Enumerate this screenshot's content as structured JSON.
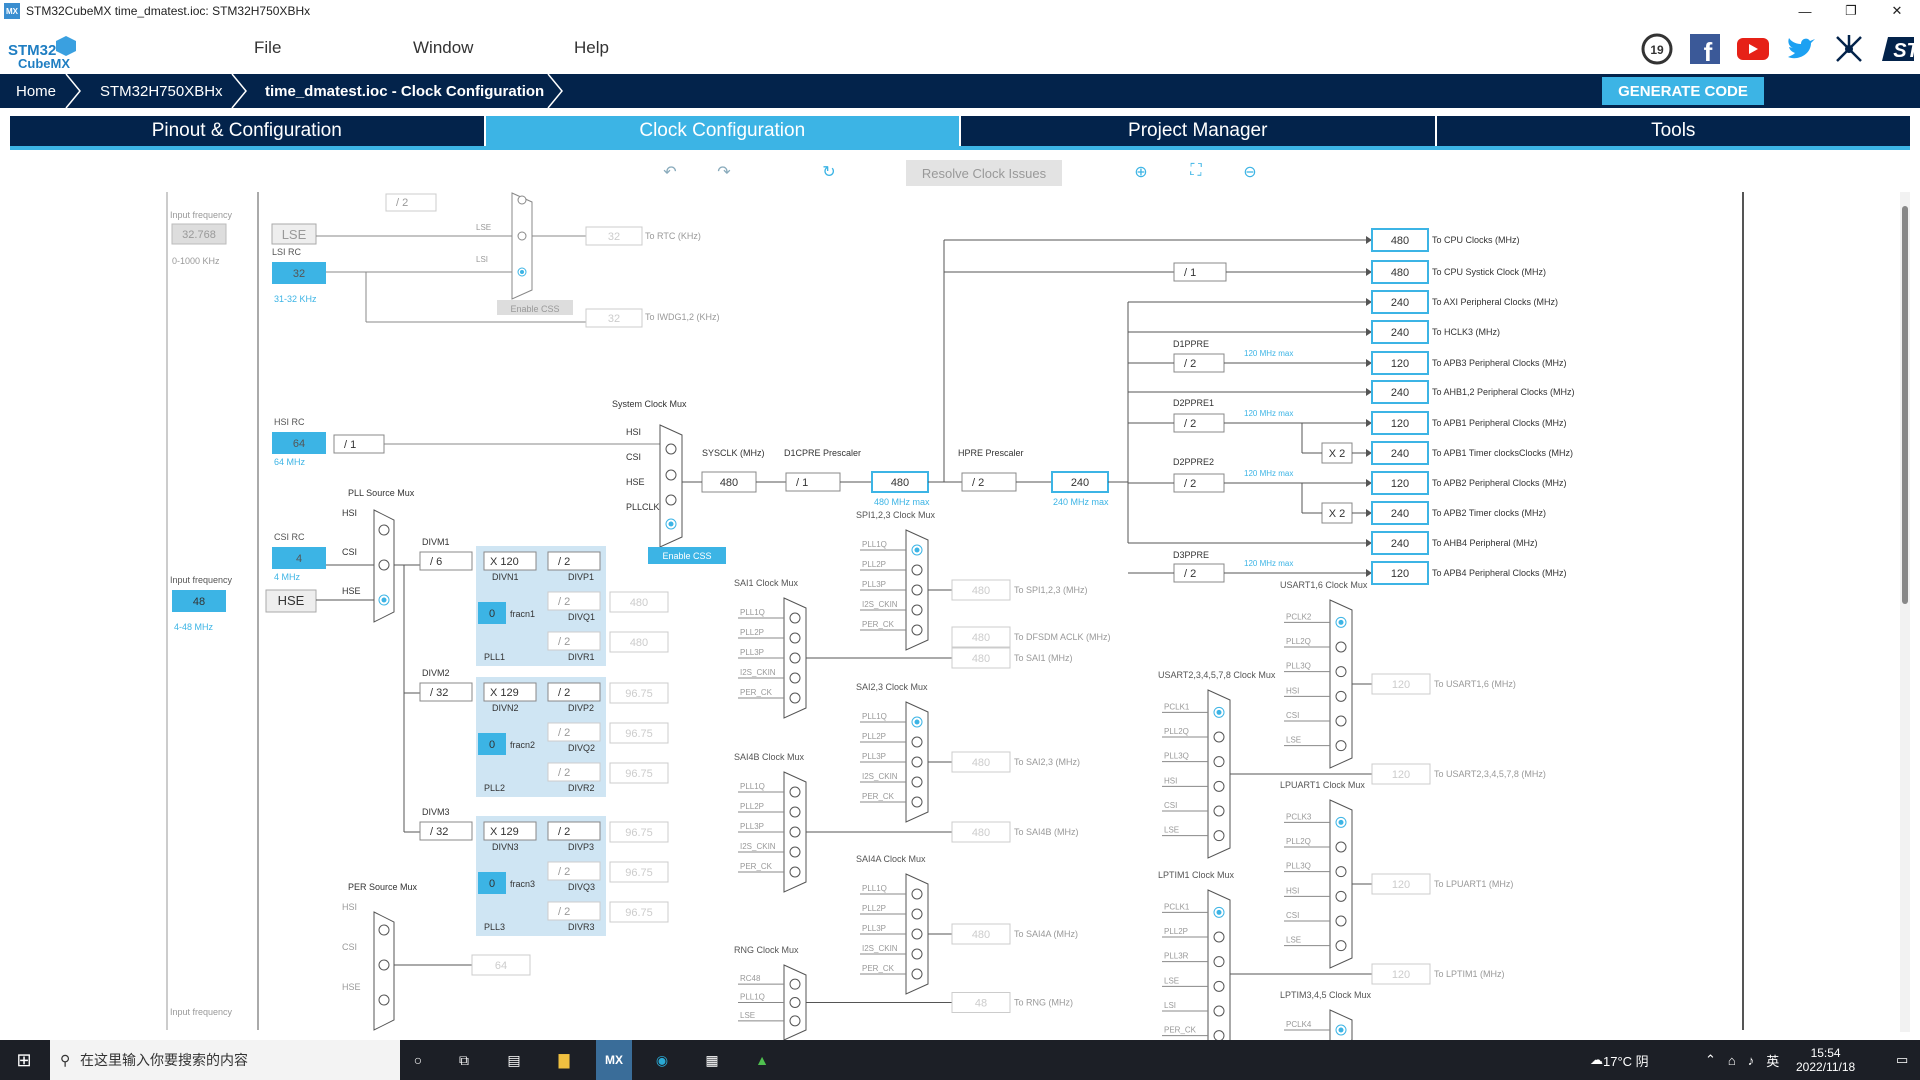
{
  "window": {
    "title": "STM32CubeMX time_dmatest.ioc: STM32H750XBHx",
    "icon": "MX"
  },
  "app": {
    "logo_line1": "STM32",
    "logo_line2": "CubeMX"
  },
  "menu": {
    "file": "File",
    "window": "Window",
    "help": "Help"
  },
  "breadcrumb": {
    "home": "Home",
    "mcu": "STM32H750XBHx",
    "current": "time_dmatest.ioc - Clock Configuration"
  },
  "generate_label": "GENERATE CODE",
  "tabs": [
    "Pinout & Configuration",
    "Clock Configuration",
    "Project Manager",
    "Tools"
  ],
  "toolbar": {
    "resolve": "Resolve Clock Issues"
  },
  "diagram": {
    "input_freq_label": "Input frequency",
    "lse_freq": "32.768",
    "lse_range": "0-1000 KHz",
    "lse": "LSE",
    "lsi_rc": "LSI RC",
    "lsi_val": "32",
    "lsi_range": "31-32 KHz",
    "rtc_val": "32",
    "rtc_label": "To RTC (KHz)",
    "iwdg_val": "32",
    "iwdg_label": "To IWDG1,2 (KHz)",
    "enable_css": "Enable CSS",
    "rtc_div": "/ 2",
    "mux_lse": "LSE",
    "mux_lsi": "LSI",
    "hsi_rc": "HSI RC",
    "hsi_val": "64",
    "hsi_mhz": "64 MHz",
    "hsi_div": "/ 1",
    "csi_rc": "CSI RC",
    "csi_val": "4",
    "csi_mhz": "4 MHz",
    "hse_freq": "48",
    "hse_range": "4-48 MHz",
    "hse": "HSE",
    "pll_src_mux": "PLL Source Mux",
    "sys_clk_mux": "System Clock Mux",
    "mux_hsi": "HSI",
    "mux_csi": "CSI",
    "mux_hse": "HSE",
    "mux_pllclk": "PLLCLK",
    "sysclk_label": "SYSCLK (MHz)",
    "sysclk": "480",
    "d1cpre_label": "D1CPRE Prescaler",
    "d1cpre": "/ 1",
    "cpu_val": "480",
    "cpu_max": "480 MHz max",
    "hpre_label": "HPRE Prescaler",
    "hpre": "/ 2",
    "hclk_val": "240",
    "hclk_max": "240 MHz max",
    "enable_css_btn": "Enable CSS",
    "divm1_label": "DIVM1",
    "divm1": "/ 6",
    "divn1": "X 120",
    "divp1": "/ 2",
    "divq1": "/ 2",
    "divr1": "/ 2",
    "divq1_val": "480",
    "divr1_val": "480",
    "fracn": "0",
    "divm2_label": "DIVM2",
    "divm2": "/ 32",
    "divn2": "X 129",
    "divp2": "/ 2",
    "divq2": "/ 2",
    "divr2": "/ 2",
    "pll2_p": "96.75",
    "pll2_q": "96.75",
    "pll2_r": "96.75",
    "divm3_label": "DIVM3",
    "divm3": "/ 32",
    "divn3": "X 129",
    "divp3": "/ 2",
    "divq3": "/ 2",
    "divr3": "/ 2",
    "pll3_p": "96.75",
    "pll3_q": "96.75",
    "pll3_r": "96.75",
    "per_src_mux": "PER Source Mux",
    "per_val": "64",
    "outputs": [
      {
        "val": "480",
        "label": "To CPU Clocks (MHz)"
      },
      {
        "val": "480",
        "label": "To CPU Systick Clock (MHz)"
      },
      {
        "val": "240",
        "label": "To AXI Peripheral Clocks (MHz)"
      },
      {
        "val": "240",
        "label": "To HCLK3 (MHz)"
      },
      {
        "val": "120",
        "label": "To APB3 Peripheral Clocks (MHz)"
      },
      {
        "val": "240",
        "label": "To AHB1,2 Peripheral Clocks (MHz)"
      },
      {
        "val": "120",
        "label": "To APB1 Peripheral Clocks (MHz)"
      },
      {
        "val": "240",
        "label": "To APB1 Timer clocksClocks (MHz)"
      },
      {
        "val": "120",
        "label": "To APB2 Peripheral Clocks (MHz)"
      },
      {
        "val": "240",
        "label": "To APB2 Timer clocks (MHz)"
      },
      {
        "val": "240",
        "label": "To AHB4 Peripheral (MHz)"
      },
      {
        "val": "120",
        "label": "To APB4 Peripheral Clocks (MHz)"
      }
    ],
    "systick_div": "/ 1",
    "d1ppre_label": "D1PPRE",
    "d1ppre": "/ 2",
    "d2ppre1_label": "D2PPRE1",
    "d2ppre1": "/ 2",
    "d2ppre2_label": "D2PPRE2",
    "d2ppre2": "/ 2",
    "d3ppre_label": "D3PPRE",
    "d3ppre": "/ 2",
    "max120": "120 MHz max",
    "x2": "X 2",
    "spi_mux": "SPI1,2,3 Clock Mux",
    "spi_val": "480",
    "spi_label": "To SPI1,2,3 (MHz)",
    "dfsdm_val": "480",
    "dfsdm_label": "To DFSDM ACLK (MHz)",
    "sai1_mux": "SAI1 Clock Mux",
    "sai1_val": "480",
    "sai1_label": "To SAI1 (MHz)",
    "sai23_mux": "SAI2,3 Clock Mux",
    "sai23_val": "480",
    "sai23_label": "To SAI2,3 (MHz)",
    "sai4b_mux": "SAI4B Clock Mux",
    "sai4b_val": "480",
    "sai4b_label": "To SAI4B (MHz)",
    "sai4a_mux": "SAI4A Clock Mux",
    "sai4a_val": "480",
    "sai4a_label": "To SAI4A (MHz)",
    "rng_mux": "RNG Clock Mux",
    "rng_val": "48",
    "rng_label": "To RNG (MHz)",
    "usart16_mux": "USART1,6 Clock Mux",
    "usart16_val": "120",
    "usart16_label": "To USART1,6 (MHz)",
    "usart2_mux": "USART2,3,4,5,7,8 Clock Mux",
    "usart2_val": "120",
    "usart2_label": "To USART2,3,4,5,7,8 (MHz)",
    "lpuart_mux": "LPUART1 Clock Mux",
    "lpuart_val": "120",
    "lpuart_label": "To LPUART1 (MHz)",
    "lptim1_mux": "LPTIM1 Clock Mux",
    "lptim1_val": "120",
    "lptim1_label": "To LPTIM1 (MHz)",
    "lptim345_mux": "LPTIM3,4,5 Clock Mux",
    "mux_inputs_spi": [
      "PLL1Q",
      "PLL2P",
      "PLL3P",
      "I2S_CKIN",
      "PER_CK"
    ],
    "mux_inputs_rng": [
      "RC48",
      "PLL1Q",
      "LSE"
    ],
    "mux_inputs_usart16": [
      "PCLK2",
      "PLL2Q",
      "PLL3Q",
      "HSI",
      "CSI",
      "LSE"
    ],
    "mux_inputs_usart2": [
      "PCLK1",
      "PLL2Q",
      "PLL3Q",
      "HSI",
      "CSI",
      "LSE"
    ],
    "mux_inputs_lpuart": [
      "PCLK3",
      "PLL2Q",
      "PLL3Q",
      "HSI",
      "CSI",
      "LSE"
    ],
    "mux_inputs_lptim1": [
      "PCLK1",
      "PLL2P",
      "PLL3R",
      "LSE",
      "LSI",
      "PER_CK"
    ],
    "mux_inputs_lptim345": [
      "PCLK4"
    ],
    "mux_inputs_per": [
      "HSI",
      "CSI",
      "HSE"
    ],
    "pll_labels": [
      "DIVN1",
      "DIVP1",
      "DIVQ1",
      "DIVR1",
      "fracn1",
      "PLL1",
      "DIVN2",
      "DIVP2",
      "DIVQ2",
      "DIVR2",
      "fracn2",
      "PLL2",
      "DIVN3",
      "DIVP3",
      "DIVQ3",
      "DIVR3",
      "fracn3",
      "PLL3"
    ]
  },
  "taskbar": {
    "search_placeholder": "在这里输入你要搜索的内容",
    "weather": "17°C  阴",
    "time": "15:54",
    "date": "2022/11/18",
    "lang": "英"
  }
}
